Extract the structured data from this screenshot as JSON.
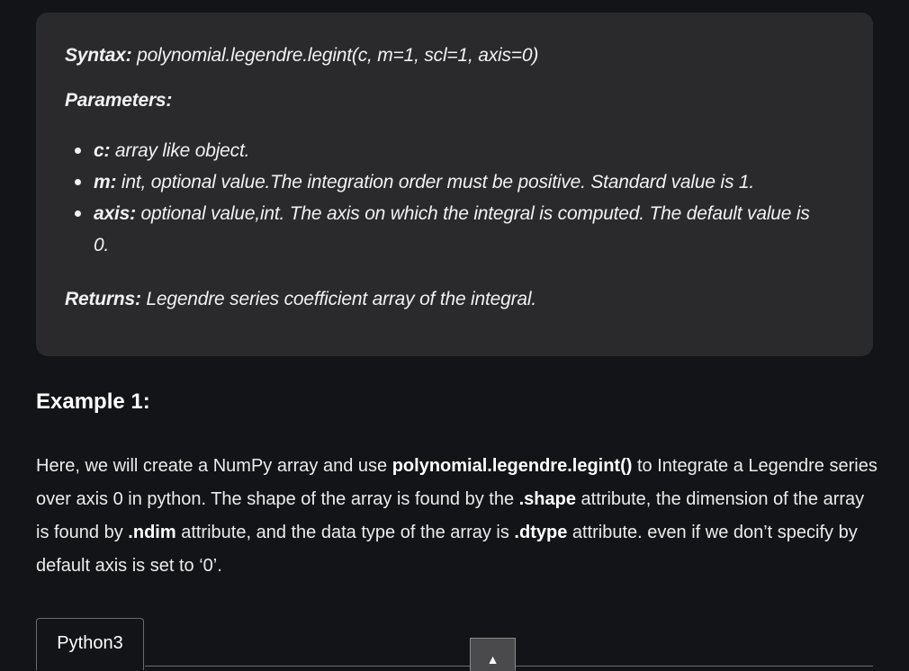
{
  "syntax_box": {
    "syntax_label": "Syntax:",
    "syntax_value": " polynomial.legendre.legint(c, m=1, scl=1, axis=0)",
    "parameters_label": "Parameters:",
    "parameters": [
      {
        "name": "c:",
        "description": " array like object."
      },
      {
        "name": "m:",
        "description": " int, optional value.The integration order must be positive. Standard value is 1."
      },
      {
        "name": "axis:",
        "description": " optional value,int. The axis on which the integral is computed. The default value is 0."
      }
    ],
    "returns_label": "Returns:",
    "returns_value": " Legendre series coefficient array of the integral."
  },
  "example": {
    "heading": "Example 1:",
    "text_1": "Here, we will create a NumPy array and use ",
    "code_1": "polynomial.legendre.legint()",
    "text_2": " to Integrate a Legendre series over axis 0 in python. The shape of the array is found by the ",
    "code_2": ".shape",
    "text_3": " attribute, the dimension of the array is found by ",
    "code_3": ".ndim",
    "text_4": " attribute, and the data type of the array is ",
    "code_4": ".dtype",
    "text_5": " attribute. even if we don’t specify by default axis is set to ‘0’."
  },
  "code_tabs": {
    "active_tab": "Python3",
    "scroll_top_icon": "▲"
  }
}
